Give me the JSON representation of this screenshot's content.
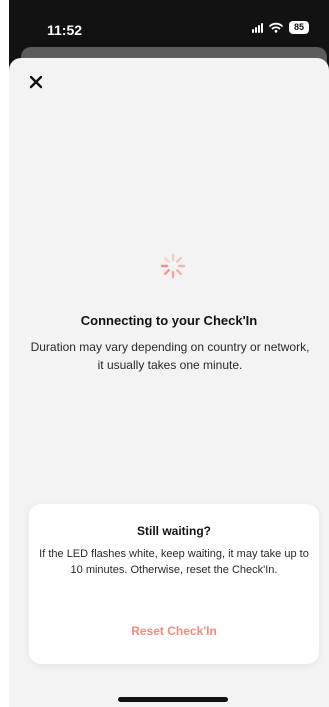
{
  "status_bar": {
    "time": "11:52",
    "battery": "85"
  },
  "icons": {
    "close": "close-icon",
    "spinner": "loading-spinner-icon",
    "signal": "cellular-signal-icon",
    "wifi": "wifi-icon"
  },
  "connecting": {
    "title": "Connecting to your Check'In",
    "subtitle": "Duration may vary depending on country or network, it usually takes one minute."
  },
  "waiting_card": {
    "title": "Still waiting?",
    "body": "If the LED flashes white, keep waiting, it may take up to 10 minutes. Otherwise, reset the Check'In.",
    "reset_label": "Reset Check'In"
  },
  "colors": {
    "accent": "#f28b80",
    "sheet_background": "#f3f3f3",
    "status_bar_background": "#121212",
    "text_primary": "#121212"
  }
}
